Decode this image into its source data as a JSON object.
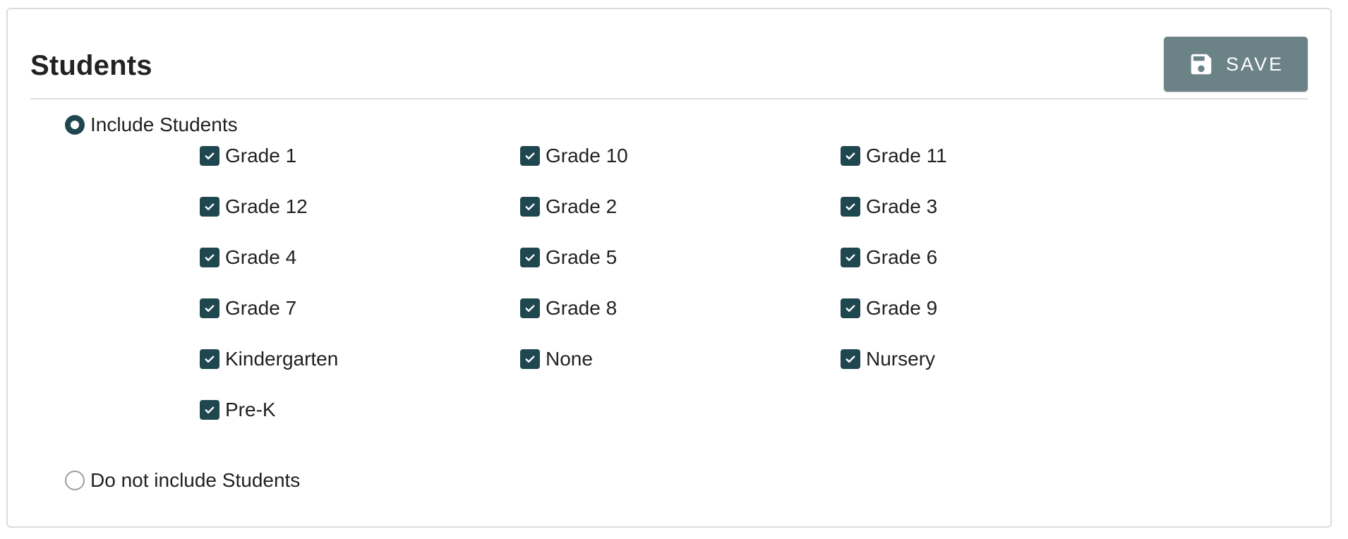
{
  "section": {
    "title": "Students",
    "save_label": "SAVE"
  },
  "include_option": {
    "label": "Include Students",
    "selected": true
  },
  "exclude_option": {
    "label": "Do not include Students",
    "selected": false
  },
  "grades": [
    {
      "label": "Grade 1",
      "checked": true
    },
    {
      "label": "Grade 10",
      "checked": true
    },
    {
      "label": "Grade 11",
      "checked": true
    },
    {
      "label": "Grade 12",
      "checked": true
    },
    {
      "label": "Grade 2",
      "checked": true
    },
    {
      "label": "Grade 3",
      "checked": true
    },
    {
      "label": "Grade 4",
      "checked": true
    },
    {
      "label": "Grade 5",
      "checked": true
    },
    {
      "label": "Grade 6",
      "checked": true
    },
    {
      "label": "Grade 7",
      "checked": true
    },
    {
      "label": "Grade 8",
      "checked": true
    },
    {
      "label": "Grade 9",
      "checked": true
    },
    {
      "label": "Kindergarten",
      "checked": true
    },
    {
      "label": "None",
      "checked": true
    },
    {
      "label": "Nursery",
      "checked": true
    },
    {
      "label": "Pre-K",
      "checked": true
    }
  ],
  "colors": {
    "accent": "#1f474f",
    "save_button": "#6b8287"
  },
  "icons": {
    "save": "floppy-disk-icon",
    "check": "checkmark-icon"
  }
}
